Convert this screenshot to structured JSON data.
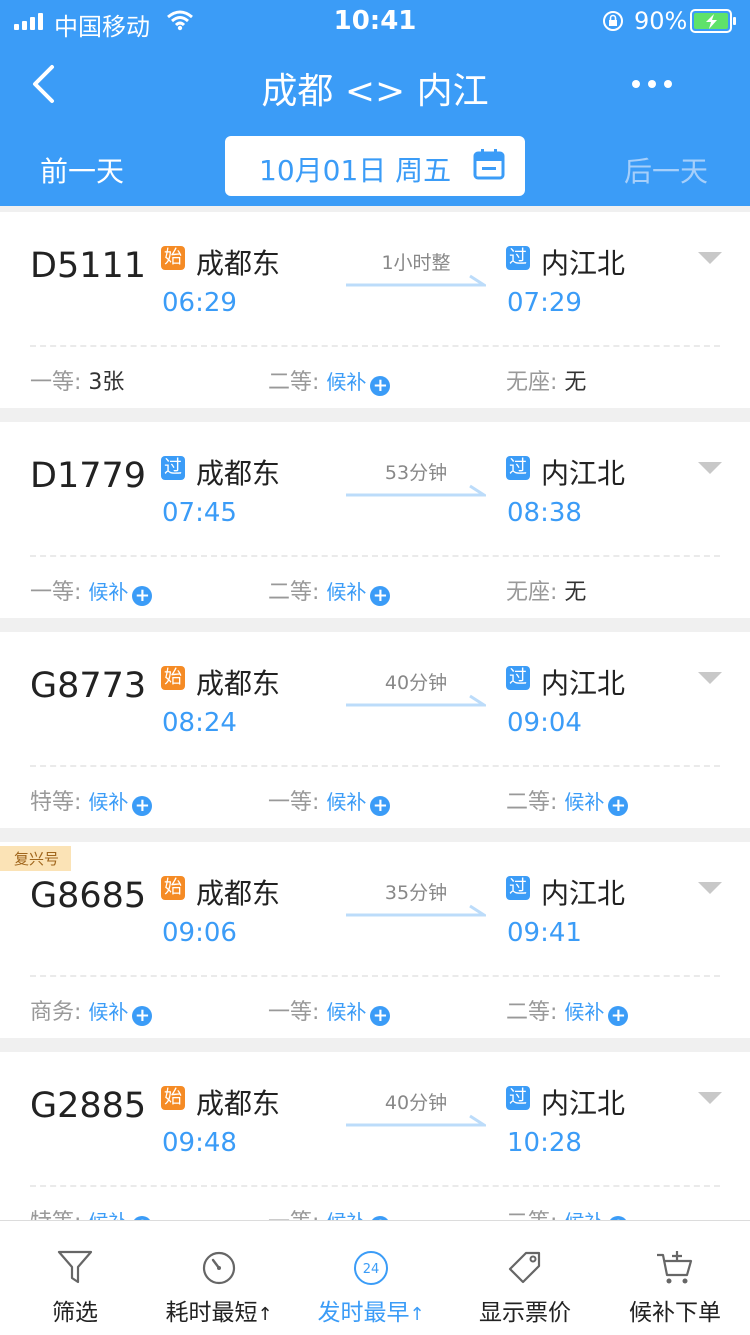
{
  "status": {
    "carrier": "中国移动",
    "time": "10:41",
    "battery": "90%"
  },
  "nav": {
    "title": "成都 <> 内江"
  },
  "datebar": {
    "prev": "前一天",
    "date": "10月01日 周五",
    "next": "后一天"
  },
  "trains": [
    {
      "number": "D5111",
      "tag": "",
      "from_badge": "始",
      "from": "成都东",
      "dep": "06:29",
      "duration": "1小时整",
      "to_badge": "过",
      "to": "内江北",
      "arr": "07:29",
      "seats": [
        {
          "label": "一等:",
          "value": "3张"
        },
        {
          "label": "二等:",
          "value": "候补"
        },
        {
          "label": "无座:",
          "value": "无"
        }
      ]
    },
    {
      "number": "D1779",
      "tag": "",
      "from_badge": "过",
      "from": "成都东",
      "dep": "07:45",
      "duration": "53分钟",
      "to_badge": "过",
      "to": "内江北",
      "arr": "08:38",
      "seats": [
        {
          "label": "一等:",
          "value": "候补"
        },
        {
          "label": "二等:",
          "value": "候补"
        },
        {
          "label": "无座:",
          "value": "无"
        }
      ]
    },
    {
      "number": "G8773",
      "tag": "",
      "from_badge": "始",
      "from": "成都东",
      "dep": "08:24",
      "duration": "40分钟",
      "to_badge": "过",
      "to": "内江北",
      "arr": "09:04",
      "seats": [
        {
          "label": "特等:",
          "value": "候补"
        },
        {
          "label": "一等:",
          "value": "候补"
        },
        {
          "label": "二等:",
          "value": "候补"
        }
      ]
    },
    {
      "number": "G8685",
      "tag": "复兴号",
      "from_badge": "始",
      "from": "成都东",
      "dep": "09:06",
      "duration": "35分钟",
      "to_badge": "过",
      "to": "内江北",
      "arr": "09:41",
      "seats": [
        {
          "label": "商务:",
          "value": "候补"
        },
        {
          "label": "一等:",
          "value": "候补"
        },
        {
          "label": "二等:",
          "value": "候补"
        }
      ]
    },
    {
      "number": "G2885",
      "tag": "",
      "from_badge": "始",
      "from": "成都东",
      "dep": "09:48",
      "duration": "40分钟",
      "to_badge": "过",
      "to": "内江北",
      "arr": "10:28",
      "seats": [
        {
          "label": "特等:",
          "value": "候补"
        },
        {
          "label": "一等:",
          "value": "候补"
        },
        {
          "label": "二等:",
          "value": "候补"
        }
      ]
    }
  ],
  "tabs": [
    {
      "label": "筛选",
      "icon": "filter-icon"
    },
    {
      "label": "耗时最短",
      "icon": "timer-icon"
    },
    {
      "label": "发时最早",
      "icon": "clock-24-icon"
    },
    {
      "label": "显示票价",
      "icon": "price-tag-icon"
    },
    {
      "label": "候补下单",
      "icon": "cart-plus-icon"
    }
  ],
  "colors": {
    "primary": "#3b9cf7",
    "start_badge": "#f58b25",
    "bg": "#f0f0f0"
  }
}
